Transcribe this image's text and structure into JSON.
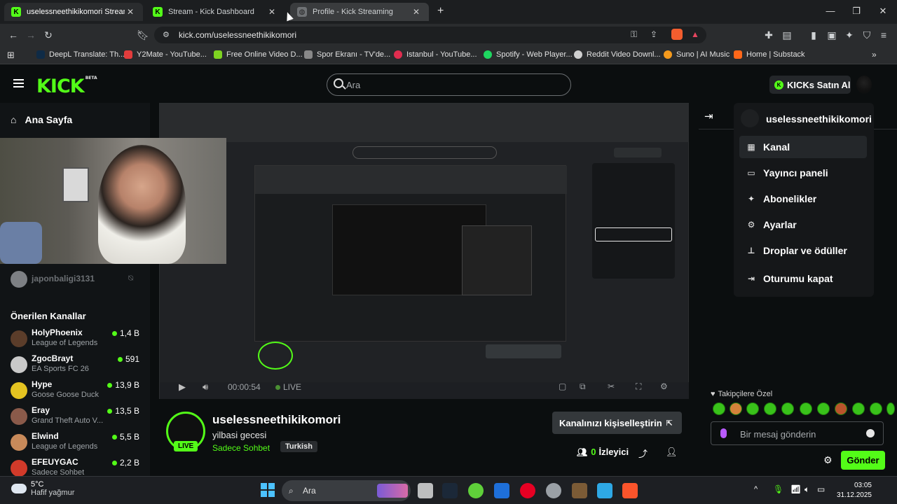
{
  "browser": {
    "tabs": [
      {
        "title": "uselessneethikikomori Stream",
        "active": true,
        "icon": "kick-favicon"
      },
      {
        "title": "Stream - Kick Dashboard",
        "active": false,
        "icon": "kick-favicon"
      },
      {
        "title": "Profile - Kick Streaming",
        "active": false,
        "icon": "globe-icon"
      }
    ],
    "url": "kick.com/uselessneethikikomori",
    "bookmarks": [
      {
        "label": "DeepL Translate: Th..."
      },
      {
        "label": "Y2Mate - YouTube..."
      },
      {
        "label": "Free Online Video D..."
      },
      {
        "label": "Spor Ekranı - TV'de..."
      },
      {
        "label": "Istanbul - YouTube..."
      },
      {
        "label": "Spotify - Web Player..."
      },
      {
        "label": "Reddit Video Downl..."
      },
      {
        "label": "Suno | AI Music"
      },
      {
        "label": "Home | Substack"
      }
    ]
  },
  "site": {
    "logo": "KICK",
    "logo_beta": "BETA",
    "search_placeholder": "Ara",
    "buy_kicks": "KICKs Satın Al"
  },
  "sidebar": {
    "home": "Ana Sayfa",
    "followed_user": "japonbaligi3131",
    "recommended_title": "Önerilen Kanallar",
    "channels": [
      {
        "name": "HolyPhoenix",
        "category": "League of Legends",
        "viewers": "1,4 B"
      },
      {
        "name": "ZgocBrayt",
        "category": "EA Sports FC 26",
        "viewers": "591"
      },
      {
        "name": "Hype",
        "category": "Goose Goose Duck",
        "viewers": "13,9 B"
      },
      {
        "name": "Eray",
        "category": "Grand Theft Auto V...",
        "viewers": "13,5 B"
      },
      {
        "name": "Elwind",
        "category": "League of Legends",
        "viewers": "5,5 B"
      },
      {
        "name": "EFEUYGAC",
        "category": "Sadece Sohbet",
        "viewers": "2,2 B"
      }
    ]
  },
  "video": {
    "elapsed": "00:00:54",
    "live": "LIVE"
  },
  "stream": {
    "channel_name": "uselessneethikikomori",
    "title": "yilbasi gecesi",
    "category": "Sadece Sohbet",
    "tag": "Turkish",
    "live_badge": "LIVE",
    "customize": "Kanalınızı kişiselleştirin",
    "viewers_count": "0",
    "viewers_label": "İzleyici"
  },
  "dropdown": {
    "username": "uselessneethikikomori",
    "items": [
      {
        "label": "Kanal",
        "icon": "channel-icon"
      },
      {
        "label": "Yayıncı paneli",
        "icon": "dashboard-icon"
      },
      {
        "label": "Abonelikler",
        "icon": "sparkle-icon"
      },
      {
        "label": "Ayarlar",
        "icon": "gear-icon"
      },
      {
        "label": "Droplar ve ödüller",
        "icon": "gift-icon"
      },
      {
        "label": "Oturumu kapat",
        "icon": "logout-icon"
      }
    ]
  },
  "chat": {
    "subs_only": "Takipçilere Özel",
    "placeholder": "Bir mesaj gönderin",
    "send": "Gönder"
  },
  "taskbar": {
    "temperature": "5°C",
    "weather": "Hafif yağmur",
    "search": "Ara",
    "time": "03:05",
    "date": "31.12.2025"
  },
  "colors": {
    "kick_green": "#53fc18",
    "background": "#0b0e0f"
  }
}
